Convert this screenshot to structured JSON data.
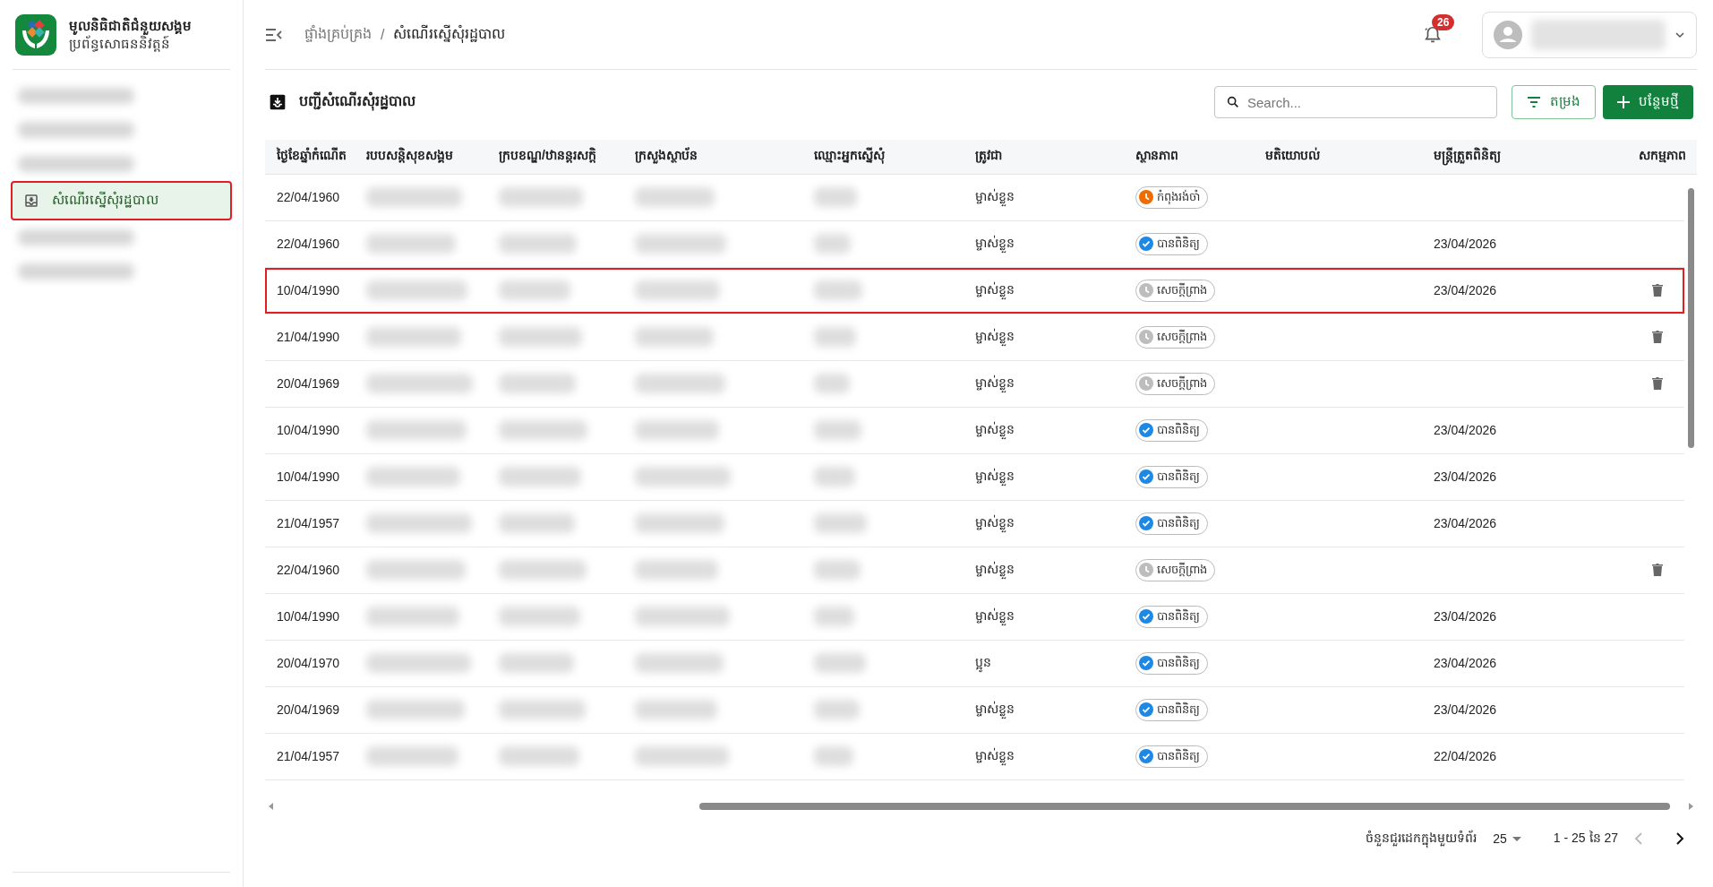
{
  "brand": {
    "title": "មូលនិធិជាតិជំនួយសង្គម",
    "subtitle": "ប្រព័ន្ធសោធននិវត្តន៍"
  },
  "sidebar": {
    "items": [
      {
        "kind": "redacted",
        "selected": false
      },
      {
        "kind": "redacted",
        "selected": false
      },
      {
        "kind": "redacted",
        "selected": false
      },
      {
        "kind": "link",
        "label": "សំណើរស្នើសុំរដ្ឋបាល",
        "selected": true
      },
      {
        "kind": "redacted",
        "selected": false
      },
      {
        "kind": "redacted",
        "selected": false
      }
    ]
  },
  "breadcrumb": [
    {
      "label": "ផ្ទាំងគ្រប់គ្រង",
      "current": false
    },
    {
      "label": "/",
      "current": false
    },
    {
      "label": "សំណើរស្នើសុំរដ្ឋបាល",
      "current": true
    }
  ],
  "notifications": {
    "count": "26"
  },
  "page_title": "បញ្ជីសំណើរសុំរដ្ឋបាល",
  "search": {
    "placeholder": "Search..."
  },
  "buttons": [
    {
      "kind": "filter",
      "label": "តម្រង"
    },
    {
      "kind": "add",
      "label": "បន្ថែមថ្មី"
    }
  ],
  "table": {
    "columns": [
      {
        "label": "ថ្ងៃខែឆ្នាំកំណើត",
        "kind": "text"
      },
      {
        "label": "របបសន្តិសុខសង្គម",
        "kind": "redacted"
      },
      {
        "label": "ក្របខណ្ឌ/ឋានន្តរសក្តិ",
        "kind": "redacted"
      },
      {
        "label": "ក្រសួងស្ថាប័ន",
        "kind": "redacted"
      },
      {
        "label": "ឈ្មោះអ្នកស្នើសុំ",
        "kind": "redacted"
      },
      {
        "label": "ត្រូវជា",
        "kind": "text"
      },
      {
        "label": "ស្ថានភាព",
        "kind": "status"
      },
      {
        "label": "មតិយោបល់",
        "kind": "text"
      },
      {
        "label": "មន្ត្រីត្រួតពិនិត្យ",
        "kind": "text"
      },
      {
        "label": "សកម្មភាព",
        "kind": "action"
      }
    ],
    "rows": [
      {
        "dob": "22/04/1960",
        "relation": "ម្ចាស់ខ្លួន",
        "status": {
          "kind": "pending",
          "label": "កំពុងរង់ចាំ"
        },
        "officer_date": "",
        "deletable": false,
        "highlighted": false
      },
      {
        "dob": "22/04/1960",
        "relation": "ម្ចាស់ខ្លួន",
        "status": {
          "kind": "verified",
          "label": "បានពិនិត្យ"
        },
        "officer_date": "23/04/2026",
        "deletable": false,
        "highlighted": false
      },
      {
        "dob": "10/04/1990",
        "relation": "ម្ចាស់ខ្លួន",
        "status": {
          "kind": "draft",
          "label": "សេចក្តីព្រាង"
        },
        "officer_date": "23/04/2026",
        "deletable": true,
        "highlighted": true
      },
      {
        "dob": "21/04/1990",
        "relation": "ម្ចាស់ខ្លួន",
        "status": {
          "kind": "draft",
          "label": "សេចក្តីព្រាង"
        },
        "officer_date": "",
        "deletable": true,
        "highlighted": false
      },
      {
        "dob": "20/04/1969",
        "relation": "ម្ចាស់ខ្លួន",
        "status": {
          "kind": "draft",
          "label": "សេចក្តីព្រាង"
        },
        "officer_date": "",
        "deletable": true,
        "highlighted": false
      },
      {
        "dob": "10/04/1990",
        "relation": "ម្ចាស់ខ្លួន",
        "status": {
          "kind": "verified",
          "label": "បានពិនិត្យ"
        },
        "officer_date": "23/04/2026",
        "deletable": false,
        "highlighted": false
      },
      {
        "dob": "10/04/1990",
        "relation": "ម្ចាស់ខ្លួន",
        "status": {
          "kind": "verified",
          "label": "បានពិនិត្យ"
        },
        "officer_date": "23/04/2026",
        "deletable": false,
        "highlighted": false
      },
      {
        "dob": "21/04/1957",
        "relation": "ម្ចាស់ខ្លួន",
        "status": {
          "kind": "verified",
          "label": "បានពិនិត្យ"
        },
        "officer_date": "23/04/2026",
        "deletable": false,
        "highlighted": false
      },
      {
        "dob": "22/04/1960",
        "relation": "ម្ចាស់ខ្លួន",
        "status": {
          "kind": "draft",
          "label": "សេចក្តីព្រាង"
        },
        "officer_date": "",
        "deletable": true,
        "highlighted": false
      },
      {
        "dob": "10/04/1990",
        "relation": "ម្ចាស់ខ្លួន",
        "status": {
          "kind": "verified",
          "label": "បានពិនិត្យ"
        },
        "officer_date": "23/04/2026",
        "deletable": false,
        "highlighted": false
      },
      {
        "dob": "20/04/1970",
        "relation": "ប្អូន",
        "status": {
          "kind": "verified",
          "label": "បានពិនិត្យ"
        },
        "officer_date": "23/04/2026",
        "deletable": false,
        "highlighted": false
      },
      {
        "dob": "20/04/1969",
        "relation": "ម្ចាស់ខ្លួន",
        "status": {
          "kind": "verified",
          "label": "បានពិនិត្យ"
        },
        "officer_date": "23/04/2026",
        "deletable": false,
        "highlighted": false
      },
      {
        "dob": "21/04/1957",
        "relation": "ម្ចាស់ខ្លួន",
        "status": {
          "kind": "verified",
          "label": "បានពិនិត្យ"
        },
        "officer_date": "22/04/2026",
        "deletable": false,
        "highlighted": false
      }
    ]
  },
  "pagination": {
    "rows_per_page_label": "ចំនួនជួរដេកក្នុងមួយទំព័រ",
    "rows_per_page": "25",
    "range": "1 - 25 នៃ 27",
    "prev_disabled": true,
    "next_disabled": false
  }
}
